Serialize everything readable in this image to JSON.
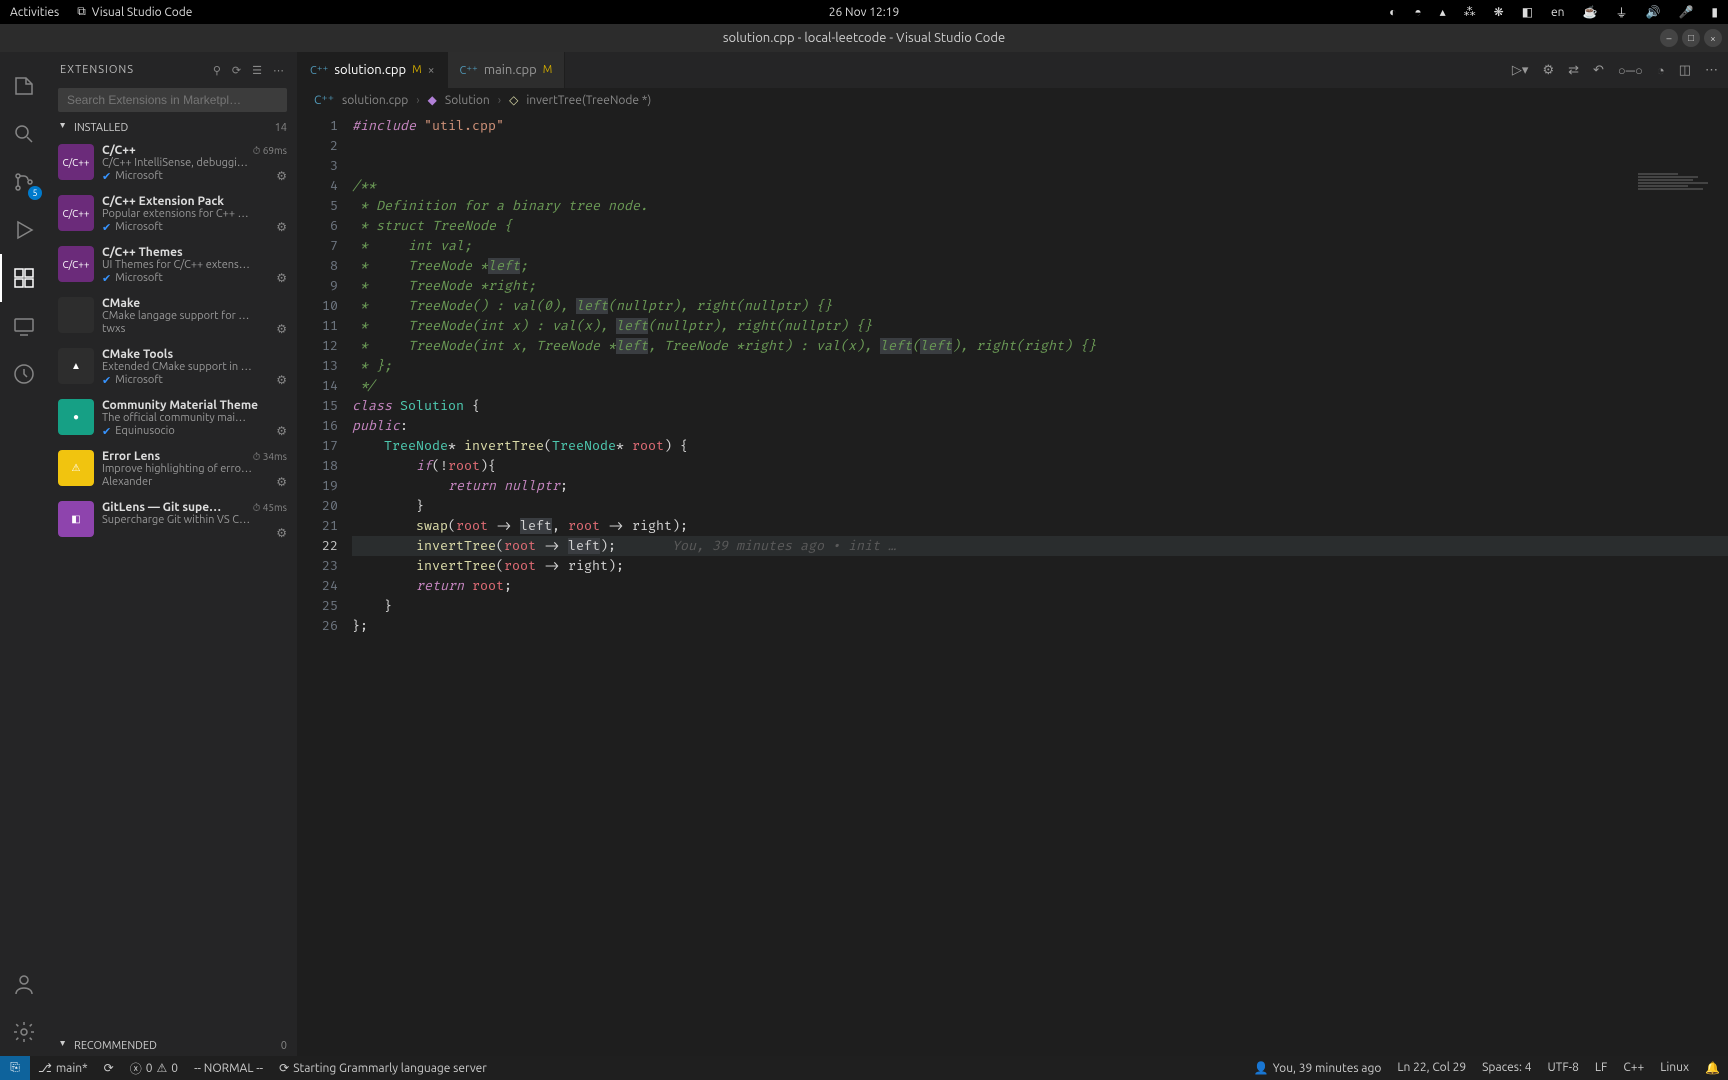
{
  "gnome": {
    "activities": "Activities",
    "app_name": "Visual Studio Code",
    "datetime": "26 Nov  12:19",
    "lang": "en"
  },
  "window": {
    "title": "solution.cpp - local-leetcode - Visual Studio Code"
  },
  "sidebar": {
    "title": "EXTENSIONS",
    "search_placeholder": "Search Extensions in Marketpl…",
    "installed_label": "INSTALLED",
    "installed_count": "14",
    "recommended_label": "RECOMMENDED",
    "recommended_count": "0",
    "items": [
      {
        "name": "C/C++",
        "desc": "C/C++ IntelliSense, debuggi…",
        "publisher": "Microsoft",
        "timing": "69ms",
        "verified": true,
        "icon": "C/C++",
        "iconbg": "#6b2b7a"
      },
      {
        "name": "C/C++ Extension Pack",
        "desc": "Popular extensions for C++ …",
        "publisher": "Microsoft",
        "timing": "",
        "verified": true,
        "icon": "C/C++",
        "iconbg": "#6b2b7a"
      },
      {
        "name": "C/C++ Themes",
        "desc": "UI Themes for C/C++ extens…",
        "publisher": "Microsoft",
        "timing": "",
        "verified": true,
        "icon": "C/C++",
        "iconbg": "#6b2b7a"
      },
      {
        "name": "CMake",
        "desc": "CMake langage support for …",
        "publisher": "twxs",
        "timing": "",
        "verified": false,
        "icon": "",
        "iconbg": "#2d2d2d"
      },
      {
        "name": "CMake Tools",
        "desc": "Extended CMake support in …",
        "publisher": "Microsoft",
        "timing": "",
        "verified": true,
        "icon": "▲",
        "iconbg": "#2d2d2d"
      },
      {
        "name": "Community Material Theme",
        "desc": "The official community mai…",
        "publisher": "Equinusocio",
        "timing": "",
        "verified": true,
        "icon": "●",
        "iconbg": "#16a085"
      },
      {
        "name": "Error Lens",
        "desc": "Improve highlighting of erro…",
        "publisher": "Alexander",
        "timing": "34ms",
        "verified": false,
        "icon": "⚠",
        "iconbg": "#f1c40f"
      },
      {
        "name": "GitLens — Git supe…",
        "desc": "Supercharge Git within VS C…",
        "publisher": "",
        "timing": "45ms",
        "verified": false,
        "icon": "◧",
        "iconbg": "#8e44ad"
      }
    ]
  },
  "scm_badge": "5",
  "tabs": [
    {
      "label": "solution.cpp",
      "modified": "M",
      "active": true
    },
    {
      "label": "main.cpp",
      "modified": "M",
      "active": false
    }
  ],
  "breadcrumb": {
    "file": "solution.cpp",
    "class": "Solution",
    "method": "invertTree(TreeNode *)"
  },
  "editor": {
    "active_line": 22,
    "lines": [
      {
        "n": 1,
        "html": "<span class='c-include'>#include</span> <span class='c-string'>\"util.cpp\"</span>"
      },
      {
        "n": 2,
        "html": ""
      },
      {
        "n": 3,
        "html": ""
      },
      {
        "n": 4,
        "html": "<span class='c-comment'>/**</span>"
      },
      {
        "n": 5,
        "html": "<span class='c-comment'> * Definition for a binary tree node.</span>"
      },
      {
        "n": 6,
        "html": "<span class='c-comment'> * struct TreeNode {</span>"
      },
      {
        "n": 7,
        "html": "<span class='c-comment'> *     int val;</span>"
      },
      {
        "n": 8,
        "html": "<span class='c-comment'> *     TreeNode *<span class='c-hl'>left</span>;</span>"
      },
      {
        "n": 9,
        "html": "<span class='c-comment'> *     TreeNode *right;</span>"
      },
      {
        "n": 10,
        "html": "<span class='c-comment'> *     TreeNode() : val(0), <span class='c-hl'>left</span>(nullptr), right(nullptr) {}</span>"
      },
      {
        "n": 11,
        "html": "<span class='c-comment'> *     TreeNode(int x) : val(x), <span class='c-hl'>left</span>(nullptr), right(nullptr) {}</span>"
      },
      {
        "n": 12,
        "html": "<span class='c-comment'> *     TreeNode(int x, TreeNode *<span class='c-hl'>left</span>, TreeNode *right) : val(x), <span class='c-hl'>left</span>(<span class='c-hl'>left</span>), right(right) {}</span>"
      },
      {
        "n": 13,
        "html": "<span class='c-comment'> * };</span>"
      },
      {
        "n": 14,
        "html": "<span class='c-comment'> */</span>"
      },
      {
        "n": 15,
        "html": "<span class='c-keyword'>class</span> <span class='c-type'>Solution</span> {"
      },
      {
        "n": 16,
        "html": "<span class='c-keyword'>public</span>:"
      },
      {
        "n": 17,
        "html": "    <span class='c-type'>TreeNode</span>* <span class='c-func'>invertTree</span>(<span class='c-type'>TreeNode</span>* <span class='c-param'>root</span>) {"
      },
      {
        "n": 18,
        "html": "        <span class='c-keyword'>if</span>(!<span class='c-param'>root</span>){"
      },
      {
        "n": 19,
        "html": "            <span class='c-keyword'>return</span> <span class='c-keyword'>nullptr</span>;"
      },
      {
        "n": 20,
        "html": "        }"
      },
      {
        "n": 21,
        "html": "        <span class='c-func'>swap</span>(<span class='c-param'>root</span> -&gt; <span class='c-hl'>left</span>, <span class='c-param'>root</span> -&gt; right);"
      },
      {
        "n": 22,
        "html": "        <span class='c-func'>invertTree</span>(<span class='c-param'>root</span> -&gt; <span class='c-hl'>left</span>);       <span class='c-blame'>You, 39 minutes ago • init …</span>"
      },
      {
        "n": 23,
        "html": "        <span class='c-func'>invertTree</span>(<span class='c-param'>root</span> -&gt; right);"
      },
      {
        "n": 24,
        "html": "        <span class='c-keyword'>return</span> <span class='c-param'>root</span>;"
      },
      {
        "n": 25,
        "html": "    }"
      },
      {
        "n": 26,
        "html": "};"
      }
    ]
  },
  "status": {
    "branch": "main*",
    "errors": "0",
    "warnings": "0",
    "vim_mode": "-- NORMAL --",
    "message": "Starting Grammarly language server",
    "blame": "You, 39 minutes ago",
    "cursor": "Ln 22, Col 29",
    "spaces": "Spaces: 4",
    "encoding": "UTF-8",
    "eol": "LF",
    "lang": "C++",
    "os": "Linux"
  }
}
